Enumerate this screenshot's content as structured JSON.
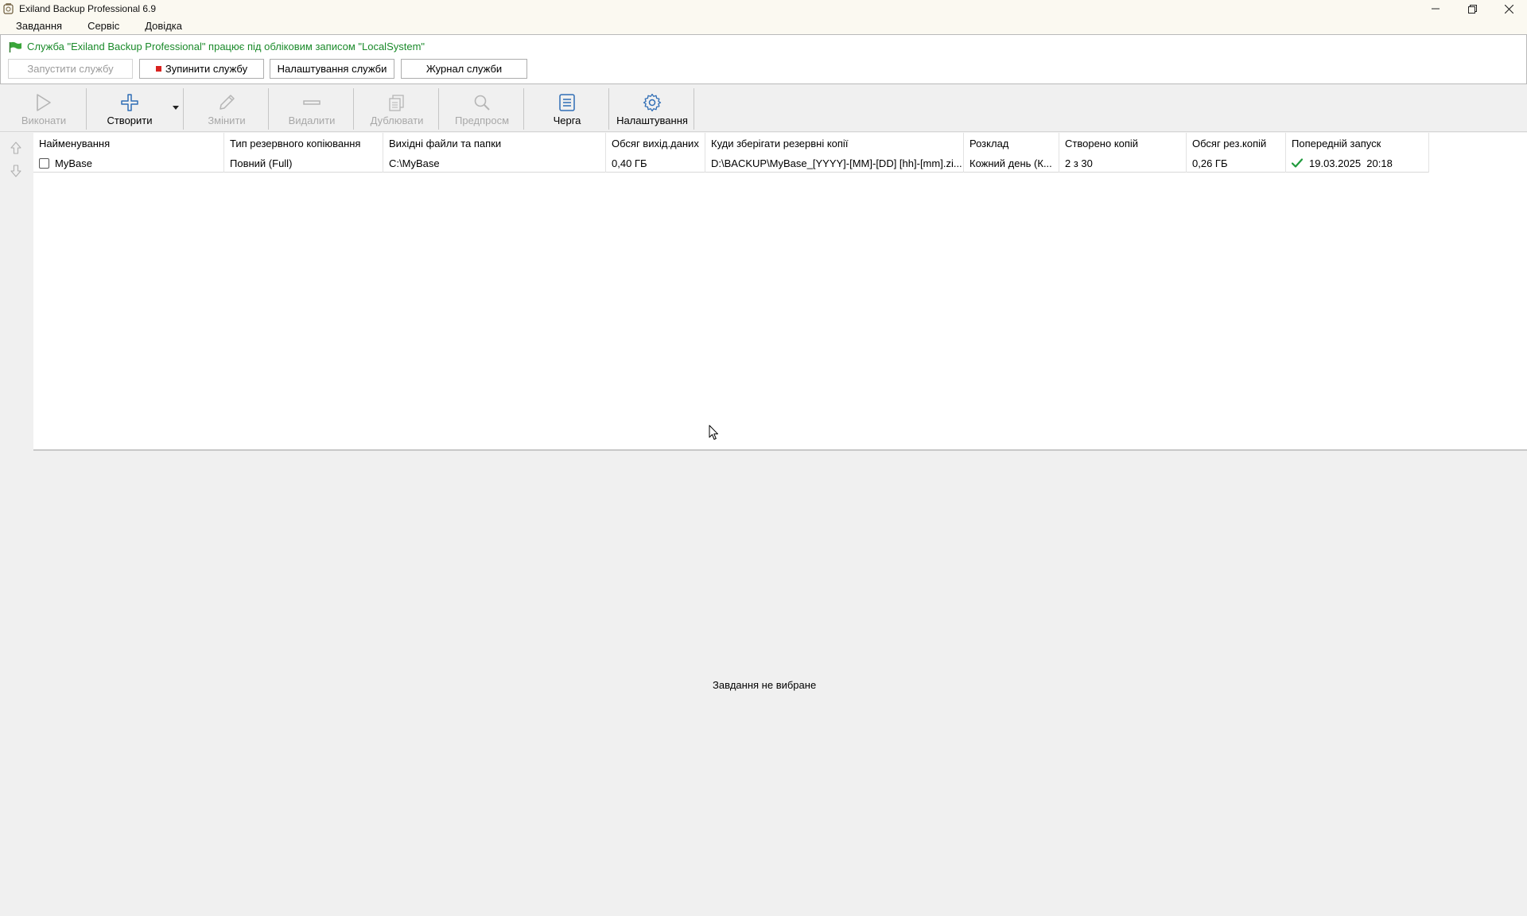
{
  "window": {
    "title": "Exiland Backup Professional 6.9"
  },
  "menu": [
    {
      "label": "Завдання"
    },
    {
      "label": "Сервіс"
    },
    {
      "label": "Довідка"
    }
  ],
  "service": {
    "status": "Служба \"Exiland Backup Professional\" працює під обліковим записом \"LocalSystem\"",
    "buttons": {
      "start": "Запустити службу",
      "stop": "Зупинити службу",
      "settings": "Налаштування служби",
      "log": "Журнал служби"
    },
    "status_color": "#1a8a2a"
  },
  "toolbar": {
    "run": "Виконати",
    "create": "Створити",
    "edit": "Змінити",
    "delete": "Видалити",
    "duplicate": "Дублювати",
    "preview": "Предпросм",
    "queue": "Черга",
    "settings": "Налаштування"
  },
  "table": {
    "columns": [
      "Найменування",
      "Тип резервного копіювання",
      "Вихідні файли та папки",
      "Обсяг вихід.даних",
      "Куди зберігати резервні копії",
      "Розклад",
      "Створено копій",
      "Обсяг рез.копій",
      "Попередній запуск"
    ],
    "rows": [
      {
        "name": "MyBase",
        "type": "Повний (Full)",
        "source": "C:\\MyBase",
        "source_size": "0,40 ГБ",
        "destination": "D:\\BACKUP\\MyBase_[YYYY]-[MM]-[DD] [hh]-[mm].zi...",
        "schedule": "Кожний день (К...",
        "copies": "2 з 30",
        "backup_size": "0,26 ГБ",
        "last_run": "19.03.2025  20:18"
      }
    ]
  },
  "details": {
    "empty_message": "Завдання не вибране"
  }
}
